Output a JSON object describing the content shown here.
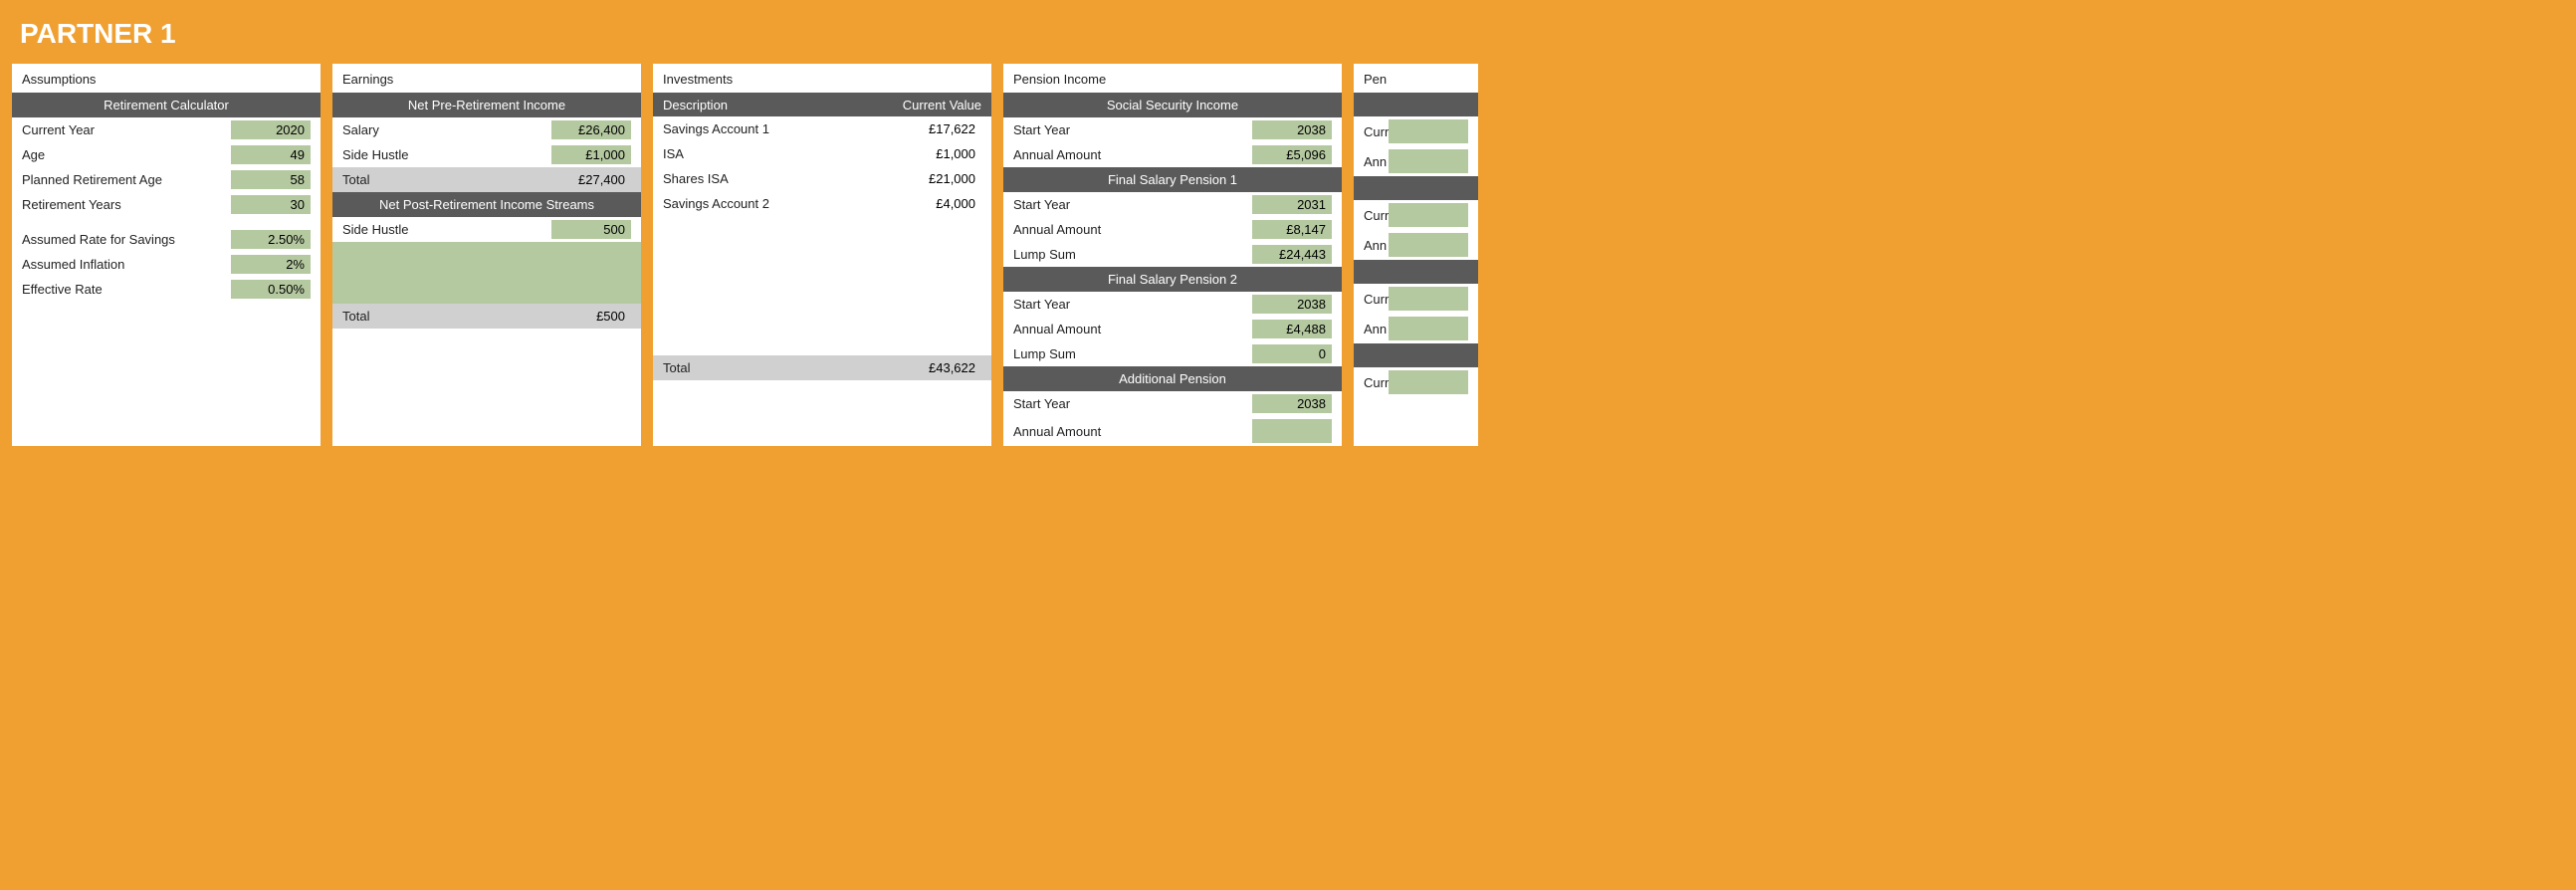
{
  "header": {
    "title": "PARTNER 1"
  },
  "assumptions": {
    "card_title": "Assumptions",
    "section_header": "Retirement Calculator",
    "rows": [
      {
        "label": "Current Year",
        "value": "2020"
      },
      {
        "label": "Age",
        "value": "49"
      },
      {
        "label": "Planned Retirement Age",
        "value": "58"
      },
      {
        "label": "Retirement Years",
        "value": "30"
      }
    ],
    "rows2": [
      {
        "label": "Assumed Rate for Savings",
        "value": "2.50%"
      },
      {
        "label": "Assumed Inflation",
        "value": "2%"
      },
      {
        "label": "Effective Rate",
        "value": "0.50%"
      }
    ]
  },
  "earnings": {
    "card_title": "Earnings",
    "pre_header": "Net Pre-Retirement Income",
    "pre_rows": [
      {
        "label": "Salary",
        "value": "£26,400"
      },
      {
        "label": "Side Hustle",
        "value": "£1,000"
      }
    ],
    "pre_total_label": "Total",
    "pre_total_value": "£27,400",
    "post_header": "Net Post-Retirement Income Streams",
    "post_rows": [
      {
        "label": "Side Hustle",
        "value": "500"
      }
    ],
    "post_total_label": "Total",
    "post_total_value": "£500"
  },
  "investments": {
    "card_title": "Investments",
    "col_description": "Description",
    "col_current_value": "Current Value",
    "rows": [
      {
        "label": "Savings Account 1",
        "value": "£17,622"
      },
      {
        "label": "ISA",
        "value": "£1,000"
      },
      {
        "label": "Shares ISA",
        "value": "£21,000"
      },
      {
        "label": "Savings Account 2",
        "value": "£4,000"
      }
    ],
    "total_label": "Total",
    "total_value": "£43,622"
  },
  "pension_income": {
    "card_title": "Pension Income",
    "sections": [
      {
        "header": "Social Security Income",
        "rows": [
          {
            "label": "Start Year",
            "value": "2038"
          },
          {
            "label": "Annual Amount",
            "value": "£5,096"
          }
        ]
      },
      {
        "header": "Final Salary Pension 1",
        "rows": [
          {
            "label": "Start Year",
            "value": "2031"
          },
          {
            "label": "Annual Amount",
            "value": "£8,147"
          },
          {
            "label": "Lump Sum",
            "value": "£24,443"
          }
        ]
      },
      {
        "header": "Final Salary Pension 2",
        "rows": [
          {
            "label": "Start Year",
            "value": "2038"
          },
          {
            "label": "Annual Amount",
            "value": "£4,488"
          },
          {
            "label": "Lump Sum",
            "value": "0"
          }
        ]
      },
      {
        "header": "Additional Pension",
        "rows": [
          {
            "label": "Start Year",
            "value": "2038"
          },
          {
            "label": "Annual Amount",
            "value": ""
          }
        ]
      }
    ]
  },
  "partial_card": {
    "card_title": "Pen",
    "sections": [
      {
        "header": "",
        "rows": [
          {
            "label": "Curr",
            "value": ""
          },
          {
            "label": "Ann",
            "value": ""
          }
        ]
      },
      {
        "header": "",
        "rows": [
          {
            "label": "Curr",
            "value": ""
          },
          {
            "label": "Ann",
            "value": ""
          }
        ]
      },
      {
        "header": "",
        "rows": [
          {
            "label": "Curr",
            "value": ""
          },
          {
            "label": "Ann",
            "value": ""
          }
        ]
      },
      {
        "header": "",
        "rows": [
          {
            "label": "Curr",
            "value": ""
          }
        ]
      }
    ]
  }
}
